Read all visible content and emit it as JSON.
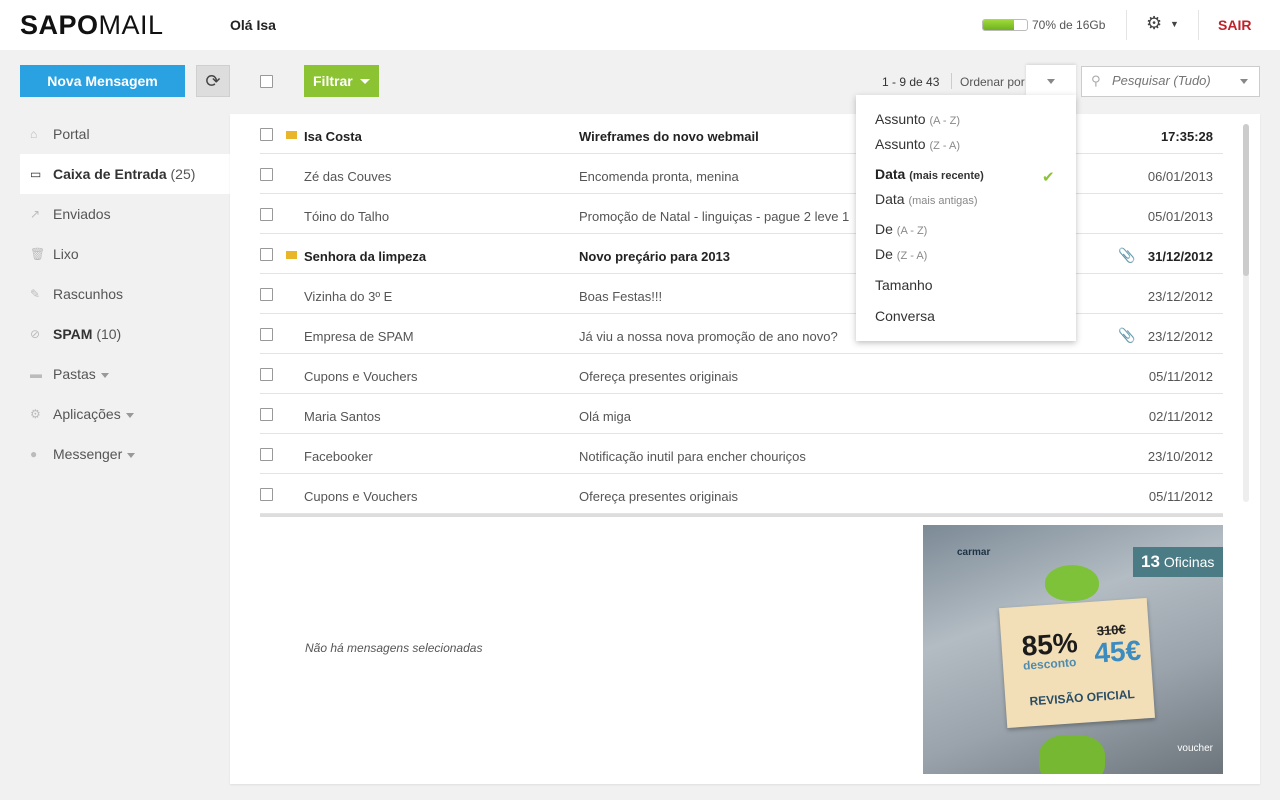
{
  "header": {
    "logo_bold": "SAPO",
    "logo_thin": "MAIL",
    "greeting": "Olá Isa",
    "quota_fraction": 0.7,
    "quota_text": "70% de 16Gb",
    "logout": "SAIR"
  },
  "toolbar": {
    "new_message": "Nova Mensagem",
    "filter": "Filtrar",
    "pager": "1 - 9 de 43",
    "sort_label": "Ordenar por",
    "search_placeholder": "Pesquisar (Tudo)"
  },
  "sidebar": {
    "items": [
      {
        "label": "Portal",
        "count": "",
        "icon": "home-icon"
      },
      {
        "label": "Caixa de Entrada",
        "count": "(25)",
        "icon": "inbox-icon"
      },
      {
        "label": "Enviados",
        "count": "",
        "icon": "sent-icon"
      },
      {
        "label": "Lixo",
        "count": "",
        "icon": "trash-icon"
      },
      {
        "label": "Rascunhos",
        "count": "",
        "icon": "draft-icon"
      },
      {
        "label": "SPAM",
        "count": "(10)",
        "icon": "spam-icon"
      },
      {
        "label": "Pastas",
        "count": "",
        "icon": "folder-icon"
      },
      {
        "label": "Aplicações",
        "count": "",
        "icon": "apps-icon"
      },
      {
        "label": "Messenger",
        "count": "",
        "icon": "chat-icon"
      }
    ]
  },
  "messages": [
    {
      "from": "Isa Costa",
      "subject": "Wireframes do novo webmail",
      "date": "17:35:28",
      "unread": true,
      "attachment": false
    },
    {
      "from": "Zé das Couves",
      "subject": "Encomenda pronta, menina",
      "date": "06/01/2013",
      "unread": false,
      "attachment": false
    },
    {
      "from": "Tóino do Talho",
      "subject": "Promoção de Natal - linguiças - pague 2 leve 1",
      "date": "05/01/2013",
      "unread": false,
      "attachment": false
    },
    {
      "from": "Senhora da limpeza",
      "subject": "Novo preçário para 2013",
      "date": "31/12/2012",
      "unread": true,
      "attachment": true
    },
    {
      "from": "Vizinha do 3º E",
      "subject": "Boas Festas!!!",
      "date": "23/12/2012",
      "unread": false,
      "attachment": false
    },
    {
      "from": "Empresa de SPAM",
      "subject": "Já viu a nossa nova promoção de ano novo?",
      "date": "23/12/2012",
      "unread": false,
      "attachment": true
    },
    {
      "from": "Cupons e Vouchers",
      "subject": "Ofereça presentes originais",
      "date": "05/11/2012",
      "unread": false,
      "attachment": false
    },
    {
      "from": "Maria Santos",
      "subject": "Olá miga",
      "date": "02/11/2012",
      "unread": false,
      "attachment": false
    },
    {
      "from": "Facebooker",
      "subject": "Notificação inutil para encher chouriços",
      "date": "23/10/2012",
      "unread": false,
      "attachment": false
    },
    {
      "from": "Cupons e Vouchers",
      "subject": "Ofereça presentes originais",
      "date": "05/11/2012",
      "unread": false,
      "attachment": false
    }
  ],
  "preview": {
    "empty_text": "Não há mensagens selecionadas"
  },
  "ad": {
    "brand": "carmar",
    "badge_number": "13",
    "badge_text": "Oficinas",
    "percent": "85%",
    "percent_label": "desconto",
    "old_price": "310€",
    "new_price": "45€",
    "tagline": "REVISÃO OFICIAL",
    "partner": "voucher"
  },
  "sort_menu": {
    "items": [
      {
        "label": "Assunto",
        "sub": "(A - Z)",
        "selected": false
      },
      {
        "label": "Assunto",
        "sub": "(Z - A)",
        "selected": false
      },
      {
        "label": "Data",
        "sub": "(mais recente)",
        "selected": true
      },
      {
        "label": "Data",
        "sub": "(mais antigas)",
        "selected": false
      },
      {
        "label": "De",
        "sub": "(A - Z)",
        "selected": false
      },
      {
        "label": "De",
        "sub": "(Z - A)",
        "selected": false
      },
      {
        "label": "Tamanho",
        "sub": "",
        "selected": false
      },
      {
        "label": "Conversa",
        "sub": "",
        "selected": false
      }
    ]
  },
  "colors": {
    "primary": "#2aa2e2",
    "filter": "#8cc332",
    "logout": "#c0222a",
    "unread_marker": "#e9b52a"
  }
}
